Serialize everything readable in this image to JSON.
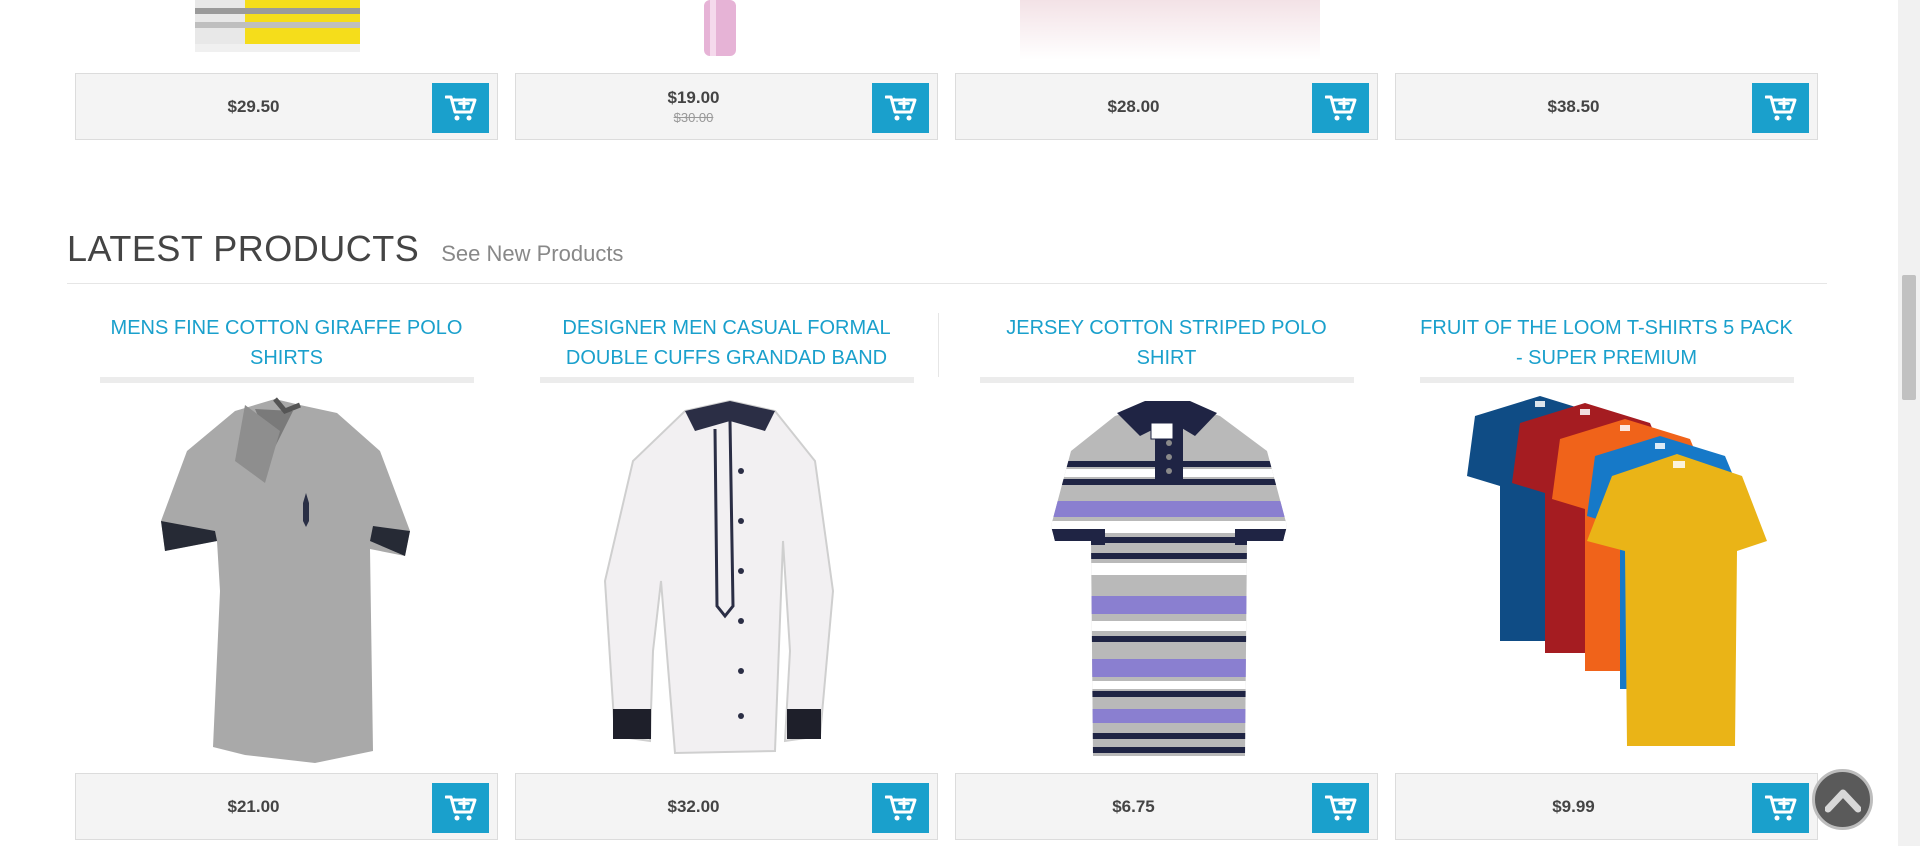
{
  "top_row": {
    "products": [
      {
        "price": "$29.50",
        "old_price": "",
        "cart_icon": "cart-plus-icon"
      },
      {
        "price": "$19.00",
        "old_price": "$30.00",
        "cart_icon": "cart-plus-icon"
      },
      {
        "price": "$28.00",
        "old_price": "",
        "cart_icon": "cart-plus-icon"
      },
      {
        "price": "$38.50",
        "old_price": "",
        "cart_icon": "cart-plus-icon"
      }
    ]
  },
  "latest": {
    "title": "LATEST PRODUCTS",
    "link": "See New Products",
    "products": [
      {
        "name": "MENS FINE COTTON GIRAFFE POLO SHIRTS",
        "price": "$21.00",
        "image": "grey polo shirt"
      },
      {
        "name": "DESIGNER MEN CASUAL FORMAL DOUBLE CUFFS GRANDAD BAND",
        "price": "$32.00",
        "image": "white casual shirt"
      },
      {
        "name": "JERSEY COTTON STRIPED POLO SHIRT",
        "price": "$6.75",
        "image": "striped polo shirt"
      },
      {
        "name": "FRUIT OF THE LOOM T-SHIRTS 5 PACK - SUPER PREMIUM",
        "price": "$9.99",
        "image": "five colored t-shirts"
      }
    ]
  },
  "colors": {
    "accent": "#1aa0cc",
    "price_bg": "#f4f4f4"
  }
}
